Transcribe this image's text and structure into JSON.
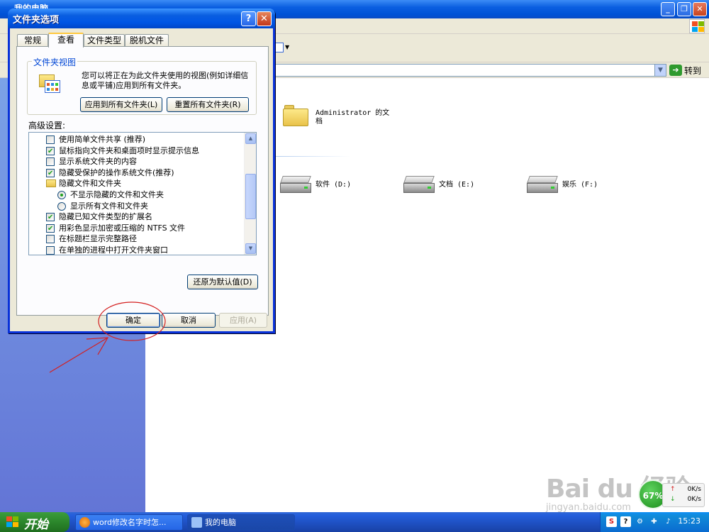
{
  "window": {
    "title": "我的电脑"
  },
  "explorer": {
    "go_label": "转到",
    "items": [
      {
        "name": "Administrator 的文\n档",
        "type": "folder"
      },
      {
        "name": "软件 (D:)",
        "type": "drive"
      },
      {
        "name": "文档 (E:)",
        "type": "drive"
      },
      {
        "name": "娱乐 (F:)",
        "type": "drive"
      }
    ]
  },
  "dialog": {
    "title": "文件夹选项",
    "tabs": [
      "常规",
      "查看",
      "文件类型",
      "脱机文件"
    ],
    "active_tab": "查看",
    "folder_views": {
      "legend": "文件夹视图",
      "description": "您可以将正在为此文件夹使用的视图(例如详细信息或平铺)应用到所有文件夹。",
      "apply_all_label": "应用到所有文件夹(L)",
      "reset_all_label": "重置所有文件夹(R)"
    },
    "advanced_label": "高级设置:",
    "advanced_items": [
      {
        "label": "使用简单文件共享 (推荐)",
        "kind": "checkbox",
        "checked": false,
        "indent": 0
      },
      {
        "label": "鼠标指向文件夹和桌面项时显示提示信息",
        "kind": "checkbox",
        "checked": true,
        "indent": 0
      },
      {
        "label": "显示系统文件夹的内容",
        "kind": "checkbox",
        "checked": false,
        "indent": 0
      },
      {
        "label": "隐藏受保护的操作系统文件(推荐)",
        "kind": "checkbox",
        "checked": true,
        "indent": 0
      },
      {
        "label": "隐藏文件和文件夹",
        "kind": "folder",
        "checked": false,
        "indent": 0
      },
      {
        "label": "不显示隐藏的文件和文件夹",
        "kind": "radio",
        "checked": true,
        "indent": 1
      },
      {
        "label": "显示所有文件和文件夹",
        "kind": "radio",
        "checked": false,
        "indent": 1
      },
      {
        "label": "隐藏已知文件类型的扩展名",
        "kind": "checkbox",
        "checked": true,
        "indent": 0
      },
      {
        "label": "用彩色显示加密或压缩的 NTFS 文件",
        "kind": "checkbox",
        "checked": true,
        "indent": 0
      },
      {
        "label": "在标题栏显示完整路径",
        "kind": "checkbox",
        "checked": false,
        "indent": 0
      },
      {
        "label": "在单独的进程中打开文件夹窗口",
        "kind": "checkbox",
        "checked": false,
        "indent": 0
      }
    ],
    "restore_defaults_label": "还原为默认值(D)",
    "ok_label": "确定",
    "cancel_label": "取消",
    "apply_label": "应用(A)"
  },
  "taskbar": {
    "start_label": "开始",
    "tasks": [
      {
        "label": "word修改名字时怎...",
        "active": false
      },
      {
        "label": "我的电脑",
        "active": true
      }
    ],
    "clock": "15:23"
  },
  "net_widget": {
    "percent": "67%",
    "up": "0K/s",
    "down": "0K/s"
  },
  "watermark": {
    "main": "Bai du 经验",
    "sub": "jingyan.baidu.com"
  },
  "colors": {
    "xp_blue": "#0055e5",
    "dialog_bg": "#ece9d8",
    "annotation_red": "#d42020"
  }
}
